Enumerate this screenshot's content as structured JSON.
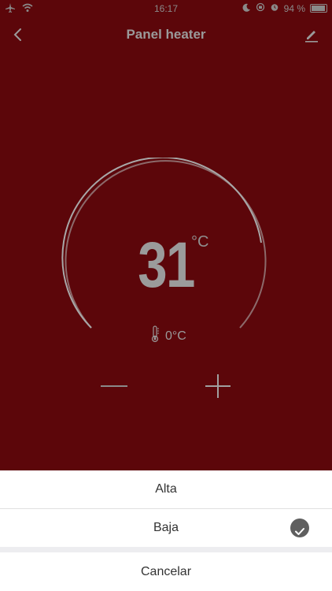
{
  "status": {
    "time": "16:17",
    "battery": "94 %"
  },
  "header": {
    "title": "Panel heater"
  },
  "thermostat": {
    "set_temperature": "31",
    "unit": "°C",
    "current_temperature": "0°C"
  },
  "sheet": {
    "options": [
      {
        "label": "Alta",
        "selected": false
      },
      {
        "label": "Baja",
        "selected": true
      }
    ],
    "cancel_label": "Cancelar"
  },
  "colors": {
    "background": "#5c060a",
    "sheet": "#ffffff"
  }
}
